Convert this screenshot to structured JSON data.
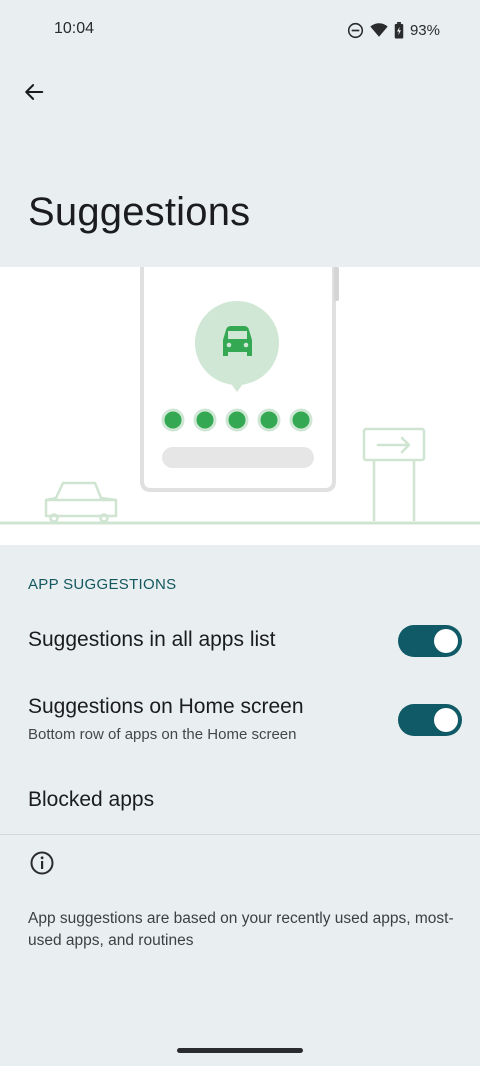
{
  "status_bar": {
    "time": "10:04",
    "battery": "93%",
    "icons": [
      "dnd-icon",
      "wifi-icon",
      "battery-icon"
    ]
  },
  "header": {
    "back_icon": "arrow-back-icon",
    "title": "Suggestions"
  },
  "hero": {
    "illustration": "phone-with-car-suggestion-illustration",
    "colors": {
      "line": "#cfe5d2",
      "accent": "#34a853",
      "bubble": "#cfe7d4",
      "phone_frame": "#e0e0e0"
    }
  },
  "app_suggestions": {
    "section_title": "APP SUGGESTIONS",
    "items": [
      {
        "title": "Suggestions in all apps list",
        "toggle_on": true
      },
      {
        "title": "Suggestions on Home screen",
        "summary": "Bottom row of apps on the Home screen",
        "toggle_on": true
      }
    ],
    "blocked_apps": "Blocked apps"
  },
  "footer": {
    "info_icon": "info-icon",
    "text": "App suggestions are based on your recently used apps, most-used apps, and routines"
  },
  "colors": {
    "background": "#e9eef1",
    "toggle_on": "#0f5a66",
    "section_header": "#13575f"
  }
}
